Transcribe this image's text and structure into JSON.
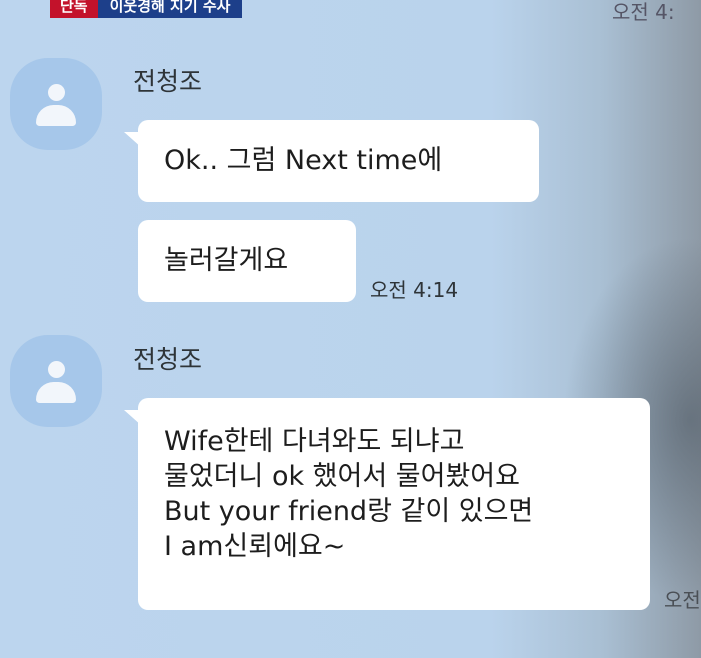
{
  "news": {
    "tag_red": "단독",
    "tag_blue": "이웃경해 지기 수사"
  },
  "top_time": "오전 4:",
  "messages": [
    {
      "sender": "전청조",
      "bubbles": [
        {
          "text": "Ok.. 그럼 Next time에"
        },
        {
          "text": "놀러갈게요",
          "time": "오전 4:14"
        }
      ]
    },
    {
      "sender": "전청조",
      "bubbles": [
        {
          "lines": [
            "Wife한테 다녀와도 되냐고",
            "물었더니 ok 했어서 물어봤어요",
            "But your friend랑 같이 있으면",
            "I am신뢰에요~"
          ]
        }
      ]
    }
  ],
  "edge_time": "오전"
}
